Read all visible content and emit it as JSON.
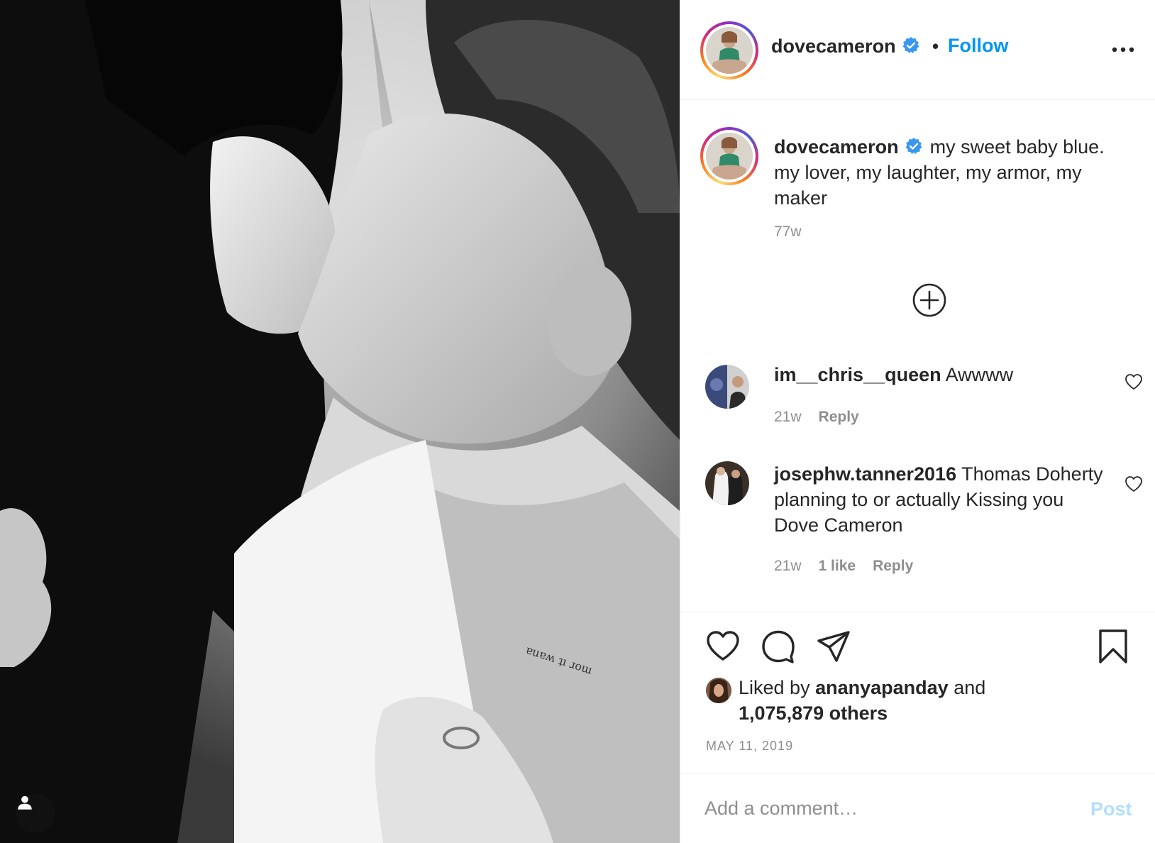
{
  "post": {
    "author": "dovecameron",
    "follow_label": "Follow",
    "dot": "•",
    "caption": "my sweet baby blue. my lover, my laughter, my armor, my maker",
    "caption_time": "77w",
    "date": "MAY 11, 2019"
  },
  "comments": [
    {
      "username": "im__chris__queen",
      "text": "Awwww",
      "time": "21w",
      "likes": "",
      "reply_label": "Reply"
    },
    {
      "username": "josephw.tanner2016",
      "text": "Thomas Doherty planning to or actually Kissing you Dove Cameron",
      "time": "21w",
      "likes": "1 like",
      "reply_label": "Reply"
    }
  ],
  "likes": {
    "prefix": "Liked by",
    "liker": "ananyapanday",
    "conjunction": "and",
    "others": "1,075,879 others"
  },
  "add_comment": {
    "placeholder": "Add a comment…",
    "post_label": "Post"
  },
  "colors": {
    "accent": "#0095f6",
    "post_disabled": "#b2dffc",
    "verified": "#3897f0",
    "secondary_text": "#8e8e8e"
  },
  "icons": {
    "more": "more-horizontal-icon",
    "verified": "verified-badge-icon",
    "load_more": "plus-circle-icon",
    "like": "heart-icon",
    "comment": "comment-bubble-icon",
    "share": "paper-plane-icon",
    "save": "bookmark-icon",
    "tag": "user-tag-icon"
  }
}
